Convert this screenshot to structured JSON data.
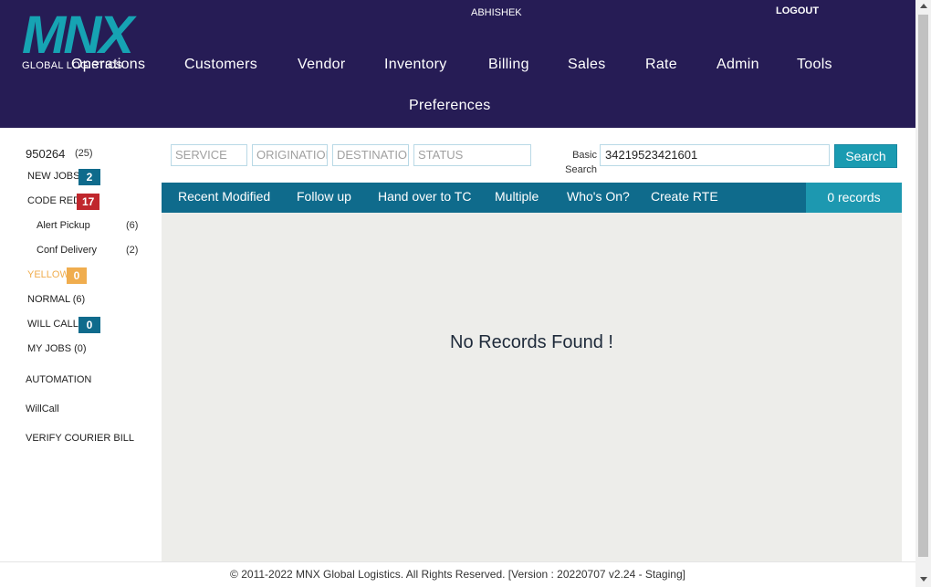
{
  "header": {
    "logo_text": "MNX",
    "logo_subtitle": "GLOBAL LOGISTICS",
    "user_name": "ABHISHEK",
    "logout_label": "LOGOUT",
    "nav": [
      "Operations",
      "Customers",
      "Vendor",
      "Inventory",
      "Billing",
      "Sales",
      "Rate",
      "Admin",
      "Tools",
      "Preferences"
    ]
  },
  "sidebar": {
    "station_id": "950264",
    "station_count": "(25)",
    "new_jobs": {
      "label": "NEW JOBS",
      "badge": "2"
    },
    "code_red": {
      "label": "CODE RED",
      "badge": "17"
    },
    "alert_pickup": {
      "label": "Alert Pickup",
      "count": "(6)"
    },
    "conf_delivery": {
      "label": "Conf Delivery",
      "count": "(2)"
    },
    "yellow": {
      "label": "YELLOW",
      "badge": "0"
    },
    "normal": {
      "label": "NORMAL (6)"
    },
    "will_call": {
      "label": "WILL CALL",
      "badge": "0"
    },
    "my_jobs": {
      "label": "MY JOBS (0)"
    },
    "automation": "AUTOMATION",
    "willcall_link": "WillCall",
    "verify_courier_bill": "VERIFY COURIER BILL"
  },
  "filters": {
    "service_placeholder": "SERVICE",
    "origination_placeholder": "ORIGINATION",
    "destination_placeholder": "DESTINATION",
    "status_placeholder": "STATUS",
    "basic_search_label_1": "Basic",
    "basic_search_label_2": "Search",
    "search_value": "34219523421601",
    "search_button": "Search"
  },
  "toolbar": {
    "items": [
      "Recent Modified",
      "Follow up",
      "Hand over to TC",
      "Multiple",
      "Who's On?",
      "Create RTE"
    ],
    "records": "0 records"
  },
  "content": {
    "empty_message": "No Records Found !"
  },
  "footer": {
    "text": "© 2011-2022 MNX Global Logistics. All Rights Reserved. [Version : 20220707 v2.24 - Staging]"
  },
  "colors": {
    "header_bg": "#261c55",
    "brand_teal": "#16a3b3",
    "toolbar_bg": "#0f6b8c",
    "badge_blue": "#0f6b8c",
    "badge_red": "#c0272d",
    "badge_yellow": "#f0ad4e"
  }
}
